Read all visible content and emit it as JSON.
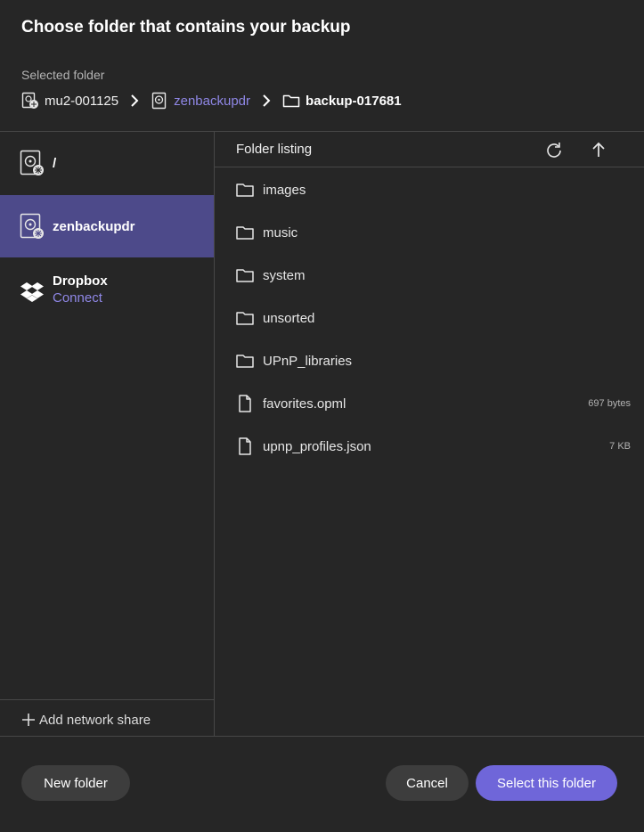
{
  "dialog": {
    "title": "Choose folder that contains your backup",
    "selected_label": "Selected folder"
  },
  "breadcrumb": [
    {
      "label": "mu2-001125",
      "icon": "network-drive-icon"
    },
    {
      "label": "zenbackupdr",
      "icon": "hard-drive-icon"
    },
    {
      "label": "backup-017681",
      "icon": "folder-icon"
    }
  ],
  "sidebar": {
    "items": [
      {
        "label": "/",
        "icon": "hard-drive-icon"
      },
      {
        "label": "zenbackupdr",
        "icon": "hard-drive-icon",
        "active": true
      },
      {
        "label": "Dropbox",
        "sub": "Connect",
        "icon": "dropbox-icon"
      }
    ],
    "add_share_label": "Add network share"
  },
  "listing": {
    "title": "Folder listing",
    "rows": [
      {
        "name": "images",
        "type": "folder",
        "size": ""
      },
      {
        "name": "music",
        "type": "folder",
        "size": ""
      },
      {
        "name": "system",
        "type": "folder",
        "size": ""
      },
      {
        "name": "unsorted",
        "type": "folder",
        "size": ""
      },
      {
        "name": "UPnP_libraries",
        "type": "folder",
        "size": ""
      },
      {
        "name": "favorites.opml",
        "type": "file",
        "size": "697 bytes"
      },
      {
        "name": "upnp_profiles.json",
        "type": "file",
        "size": "7 KB"
      }
    ]
  },
  "buttons": {
    "new_folder": "New folder",
    "cancel": "Cancel",
    "select": "Select this folder"
  },
  "colors": {
    "background": "#262626",
    "accent": "#6f66d9",
    "active_item": "#4d4a8a",
    "link": "#8f87e6"
  }
}
